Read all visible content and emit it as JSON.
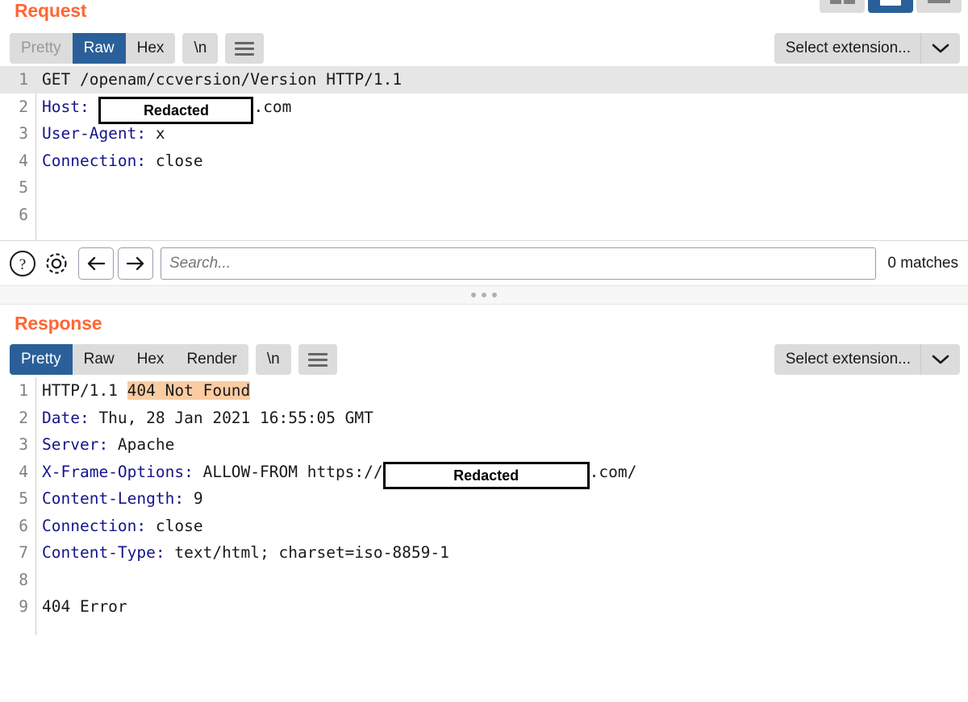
{
  "layout_toggles": [
    {
      "name": "split-vertical-view",
      "selected": false
    },
    {
      "name": "split-horizontal-view",
      "selected": true
    },
    {
      "name": "single-tab-view",
      "selected": false
    }
  ],
  "request": {
    "title": "Request",
    "tabs": [
      {
        "label": "Pretty",
        "selected": false,
        "muted": true
      },
      {
        "label": "Raw",
        "selected": true,
        "muted": false
      },
      {
        "label": "Hex",
        "selected": false,
        "muted": false
      }
    ],
    "newline_button": "\\n",
    "menu_button": "menu",
    "select_extension": "Select extension...",
    "lines": [
      {
        "n": "1",
        "highlighted": true,
        "header": "",
        "text": "GET /openam/ccversion/Version HTTP/1.1"
      },
      {
        "n": "2",
        "highlighted": false,
        "header": "Host:",
        "text": " ",
        "redacted": "Redacted",
        "after": ".com"
      },
      {
        "n": "3",
        "highlighted": false,
        "header": "User-Agent:",
        "text": " x"
      },
      {
        "n": "4",
        "highlighted": false,
        "header": "Connection:",
        "text": " close"
      },
      {
        "n": "5",
        "highlighted": false,
        "header": "",
        "text": ""
      },
      {
        "n": "6",
        "highlighted": false,
        "header": "",
        "text": ""
      }
    ]
  },
  "search": {
    "help_icon": "question-mark-circle-icon",
    "settings_icon": "gear-icon",
    "prev_icon": "arrow-left-icon",
    "next_icon": "arrow-right-icon",
    "placeholder": "Search...",
    "value": "",
    "match_count": "0 matches"
  },
  "response": {
    "title": "Response",
    "tabs": [
      {
        "label": "Pretty",
        "selected": true,
        "muted": false
      },
      {
        "label": "Raw",
        "selected": false,
        "muted": false
      },
      {
        "label": "Hex",
        "selected": false,
        "muted": false
      },
      {
        "label": "Render",
        "selected": false,
        "muted": false
      }
    ],
    "newline_button": "\\n",
    "menu_button": "menu",
    "select_extension": "Select extension...",
    "lines": [
      {
        "n": "1",
        "header": "",
        "pre": "HTTP/1.1 ",
        "marked": "404 Not Found",
        "text": ""
      },
      {
        "n": "2",
        "header": "Date:",
        "text": " Thu, 28 Jan 2021 16:55:05 GMT"
      },
      {
        "n": "3",
        "header": "Server:",
        "text": " Apache"
      },
      {
        "n": "4",
        "header": "X-Frame-Options:",
        "text": " ALLOW-FROM https://",
        "redacted": "Redacted",
        "after": ".com/"
      },
      {
        "n": "5",
        "header": "Content-Length:",
        "text": " 9"
      },
      {
        "n": "6",
        "header": "Connection:",
        "text": " close"
      },
      {
        "n": "7",
        "header": "Content-Type:",
        "text": " text/html; charset=iso-8859-1"
      },
      {
        "n": "8",
        "header": "",
        "text": ""
      },
      {
        "n": "9",
        "header": "",
        "text": "404 Error"
      }
    ]
  },
  "colors": {
    "accent": "#ff6633",
    "tab_selected": "#2a6099",
    "header_key": "#15158c",
    "highlight_line": "#e6e6e6",
    "mark_highlight": "#fbcca3"
  }
}
